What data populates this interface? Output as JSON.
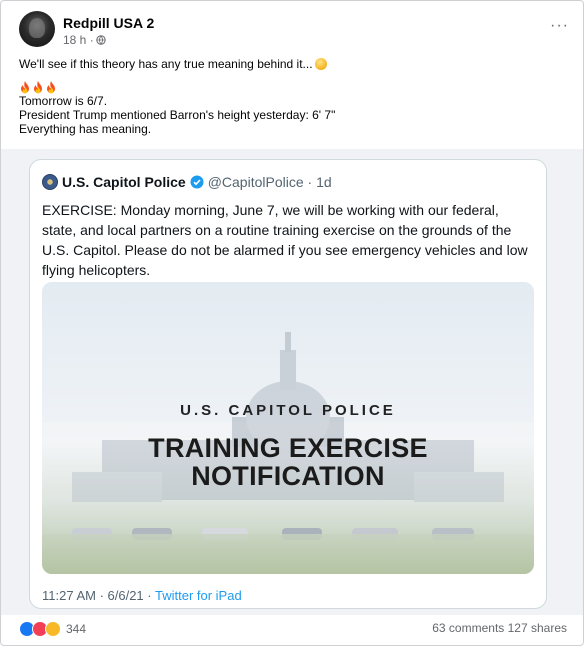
{
  "post": {
    "author": "Redpill USA 2",
    "time": "18 h ·",
    "more": "···",
    "lines": [
      "We'll see if this theory has any true meaning behind it...",
      "Tomorrow is 6/7.",
      "President Trump mentioned Barron's height yesterday: 6' 7\"",
      "Everything has meaning."
    ]
  },
  "tweet": {
    "name": "U.S. Capitol Police",
    "handle": "@CapitolPolice · 1d",
    "body": "EXERCISE: Monday morning, June 7, we will be working with our federal, state, and local partners on a routine training exercise on the grounds of the U.S. Capitol. Please do not be alarmed if you see emergency vehicles and low flying helicopters.",
    "media_subtitle": "U.S. CAPITOL POLICE",
    "media_title_1": "TRAINING EXERCISE",
    "media_title_2": "NOTIFICATION",
    "footer_time": "11:27 AM · 6/6/21 · ",
    "footer_source": "Twitter for iPad"
  },
  "stats": {
    "reaction_count": "344",
    "comments_shares": "63 comments  127 shares"
  },
  "icons": [
    "avatar",
    "globe-icon",
    "more-icon",
    "wink-emoji-icon",
    "fire-emoji-icon",
    "capitol-seal-icon",
    "verified-badge-icon",
    "like-reaction-icon",
    "love-reaction-icon",
    "wow-reaction-icon"
  ],
  "colors": {
    "link_blue": "#1d9bf0",
    "fb_blue": "#1877f2",
    "meta_gray": "#65676b"
  }
}
